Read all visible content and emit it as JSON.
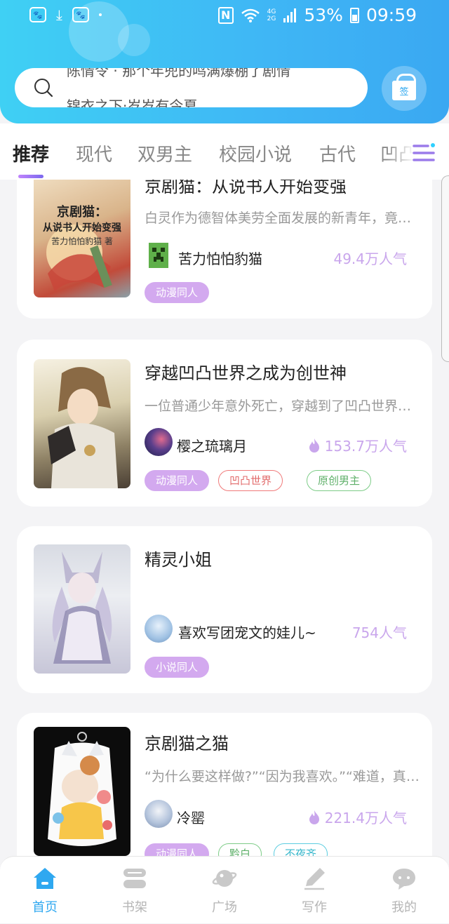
{
  "status_bar": {
    "battery": "53%",
    "time": "09:59",
    "network_top": "4G",
    "network_bottom": "2G"
  },
  "search": {
    "scroll_line_1": "陈情令 · 那个年兜的鸣满爆棚了剧情",
    "scroll_line_2": "锦衣之下·岁岁有今夏"
  },
  "signin": {
    "label": "签"
  },
  "tabs": [
    {
      "label": "推荐",
      "active": true
    },
    {
      "label": "现代"
    },
    {
      "label": "双男主"
    },
    {
      "label": "校园小说"
    },
    {
      "label": "古代"
    },
    {
      "label": "凹凸"
    }
  ],
  "books": [
    {
      "title": "京剧猫：从说书人开始变强",
      "description": "白灵作为德智体美劳全面发展的新青年，竟然穿越到了京剧猫的世界",
      "author": "苦力怕怕豹猫",
      "popularity": "49.4万人气",
      "hot": false,
      "tags": [
        {
          "label": "动漫同人",
          "style": "purple"
        }
      ],
      "cover_text_1": "京剧猫：",
      "cover_text_2": "从说书人开始变强",
      "cover_text_3": "苦力怕怕豹猫 著"
    },
    {
      "title": "穿越凹凸世界之成为创世神",
      "description": "一位普通少年意外死亡，穿越到了凹凸世界，成为了创世神",
      "author": "樱之琉璃月",
      "popularity": "153.7万人气",
      "hot": true,
      "tags": [
        {
          "label": "动漫同人",
          "style": "purple"
        },
        {
          "label": "凹凸世界",
          "style": "red"
        },
        {
          "label": "原创男主",
          "style": "green"
        }
      ]
    },
    {
      "title": "精灵小姐",
      "description": "",
      "author": "喜欢写团宠文的娃儿~",
      "popularity": "754人气",
      "hot": false,
      "tags": [
        {
          "label": "小说同人",
          "style": "purple"
        }
      ]
    },
    {
      "title": "京剧猫之猫",
      "description": "“为什么要这样做?”“因为我喜欢。”“难道，真的只是因为喜欢吗",
      "author": "冷罂",
      "popularity": "221.4万人气",
      "hot": true,
      "tags": [
        {
          "label": "动漫同人",
          "style": "purple"
        },
        {
          "label": "黔白",
          "style": "green"
        },
        {
          "label": "不夜齐",
          "style": "cyan"
        }
      ]
    }
  ],
  "bottom_nav": [
    {
      "label": "首页",
      "icon": "home-icon",
      "active": true
    },
    {
      "label": "书架",
      "icon": "bookshelf-icon"
    },
    {
      "label": "广场",
      "icon": "planet-icon"
    },
    {
      "label": "写作",
      "icon": "pen-icon"
    },
    {
      "label": "我的",
      "icon": "chat-bubble-icon"
    }
  ],
  "colors": {
    "header": "#3fb6f5",
    "accent": "#2fa8f0",
    "tag_purple": "#d3a9ef",
    "popularity": "#c9a6ec"
  }
}
